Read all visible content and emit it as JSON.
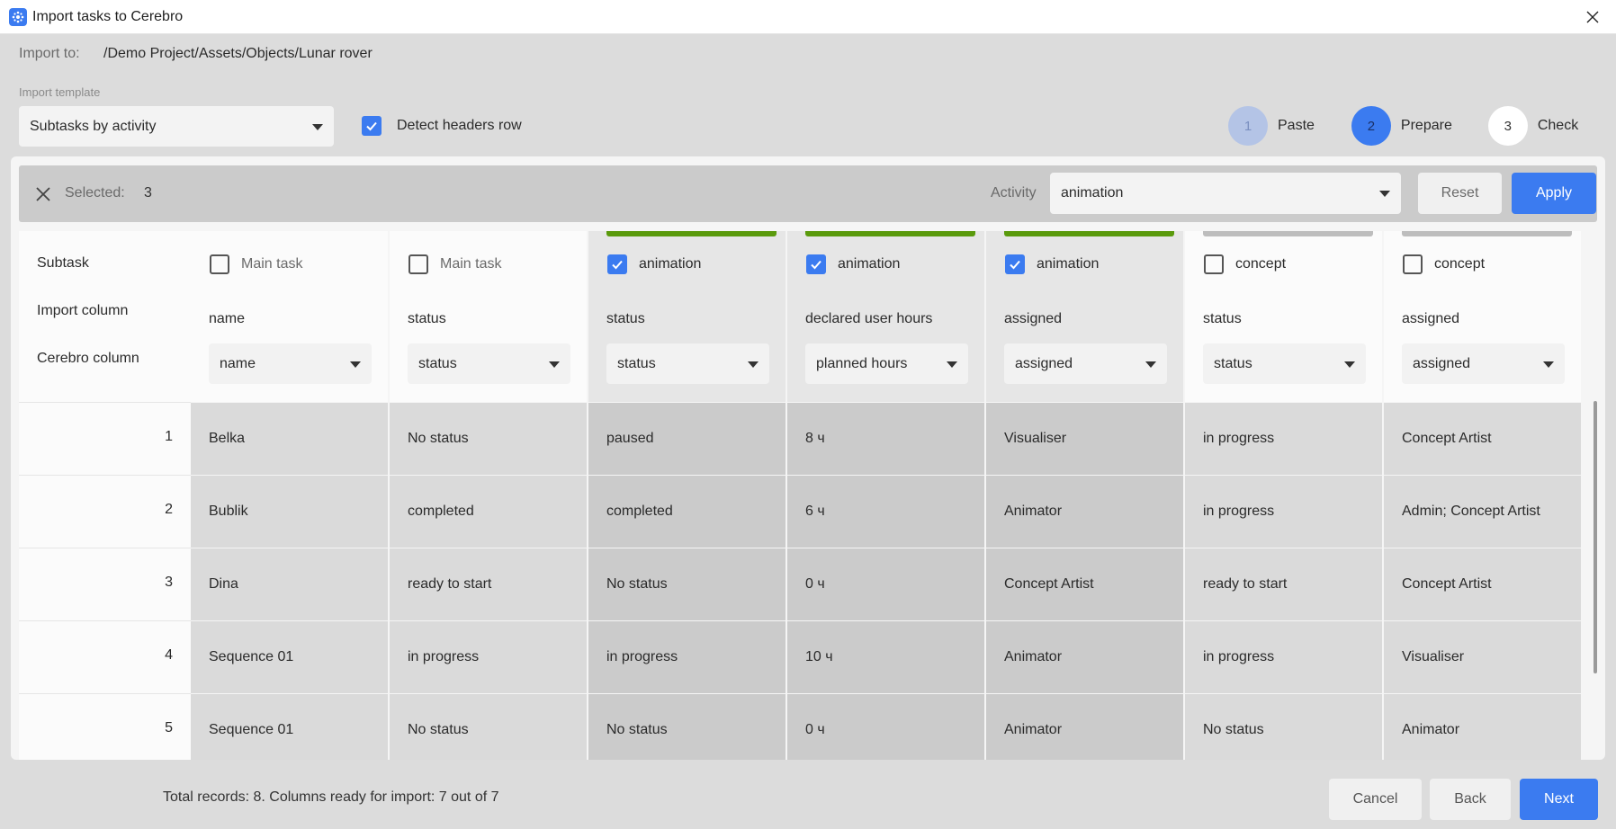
{
  "window": {
    "title": "Import tasks to Cerebro",
    "accent": "#3b7bf0"
  },
  "import_to": {
    "label": "Import to:",
    "path": "/Demo Project/Assets/Objects/Lunar rover"
  },
  "template": {
    "label": "Import template",
    "value": "Subtasks by activity"
  },
  "detect_headers": {
    "label": "Detect headers row",
    "checked": true
  },
  "steps": [
    {
      "num": "1",
      "label": "Paste",
      "state": "done"
    },
    {
      "num": "2",
      "label": "Prepare",
      "state": "active"
    },
    {
      "num": "3",
      "label": "Check",
      "state": "pending"
    }
  ],
  "selection_bar": {
    "selected_label": "Selected:",
    "selected_count": "3",
    "activity_label": "Activity",
    "activity_value": "animation",
    "reset_label": "Reset",
    "apply_label": "Apply"
  },
  "row_labels": {
    "subtask": "Subtask",
    "import_column": "Import column",
    "cerebro_column": "Cerebro column"
  },
  "columns": [
    {
      "subtask": "Main task",
      "checked": false,
      "import_col": "name",
      "cerebro_col": "name",
      "bar": "",
      "selected": false
    },
    {
      "subtask": "Main task",
      "checked": false,
      "import_col": "status",
      "cerebro_col": "status",
      "bar": "",
      "selected": false
    },
    {
      "subtask": "animation",
      "checked": true,
      "import_col": "status",
      "cerebro_col": "status",
      "bar": "#5a9a0c",
      "selected": true
    },
    {
      "subtask": "animation",
      "checked": true,
      "import_col": "declared user hours",
      "cerebro_col": "planned hours",
      "bar": "#5a9a0c",
      "selected": true
    },
    {
      "subtask": "animation",
      "checked": true,
      "import_col": "assigned",
      "cerebro_col": "assigned",
      "bar": "#5a9a0c",
      "selected": true
    },
    {
      "subtask": "concept",
      "checked": false,
      "import_col": "status",
      "cerebro_col": "status",
      "bar": "#bdbdbd",
      "selected": false
    },
    {
      "subtask": "concept",
      "checked": false,
      "import_col": "assigned",
      "cerebro_col": "assigned",
      "bar": "#bdbdbd",
      "selected": false
    }
  ],
  "rows": [
    {
      "num": "1",
      "cells": [
        "Belka",
        "No status",
        "paused",
        "8 ч",
        "Visualiser",
        "in progress",
        "Concept Artist"
      ]
    },
    {
      "num": "2",
      "cells": [
        "Bublik",
        "completed",
        "completed",
        "6 ч",
        "Animator",
        "in progress",
        "Admin; Concept Artist"
      ]
    },
    {
      "num": "3",
      "cells": [
        "Dina",
        "ready to start",
        "No status",
        "0 ч",
        "Concept Artist",
        "ready to start",
        "Concept Artist"
      ]
    },
    {
      "num": "4",
      "cells": [
        "Sequence 01",
        "in progress",
        "in progress",
        "10 ч",
        "Animator",
        "in progress",
        "Visualiser"
      ]
    },
    {
      "num": "5",
      "cells": [
        "Sequence 01",
        "No status",
        "No status",
        "0 ч",
        "Animator",
        "No status",
        "Animator"
      ]
    }
  ],
  "footer": {
    "info": "Total records: 8. Columns ready for import: 7 out of 7",
    "cancel_label": "Cancel",
    "back_label": "Back",
    "next_label": "Next"
  }
}
